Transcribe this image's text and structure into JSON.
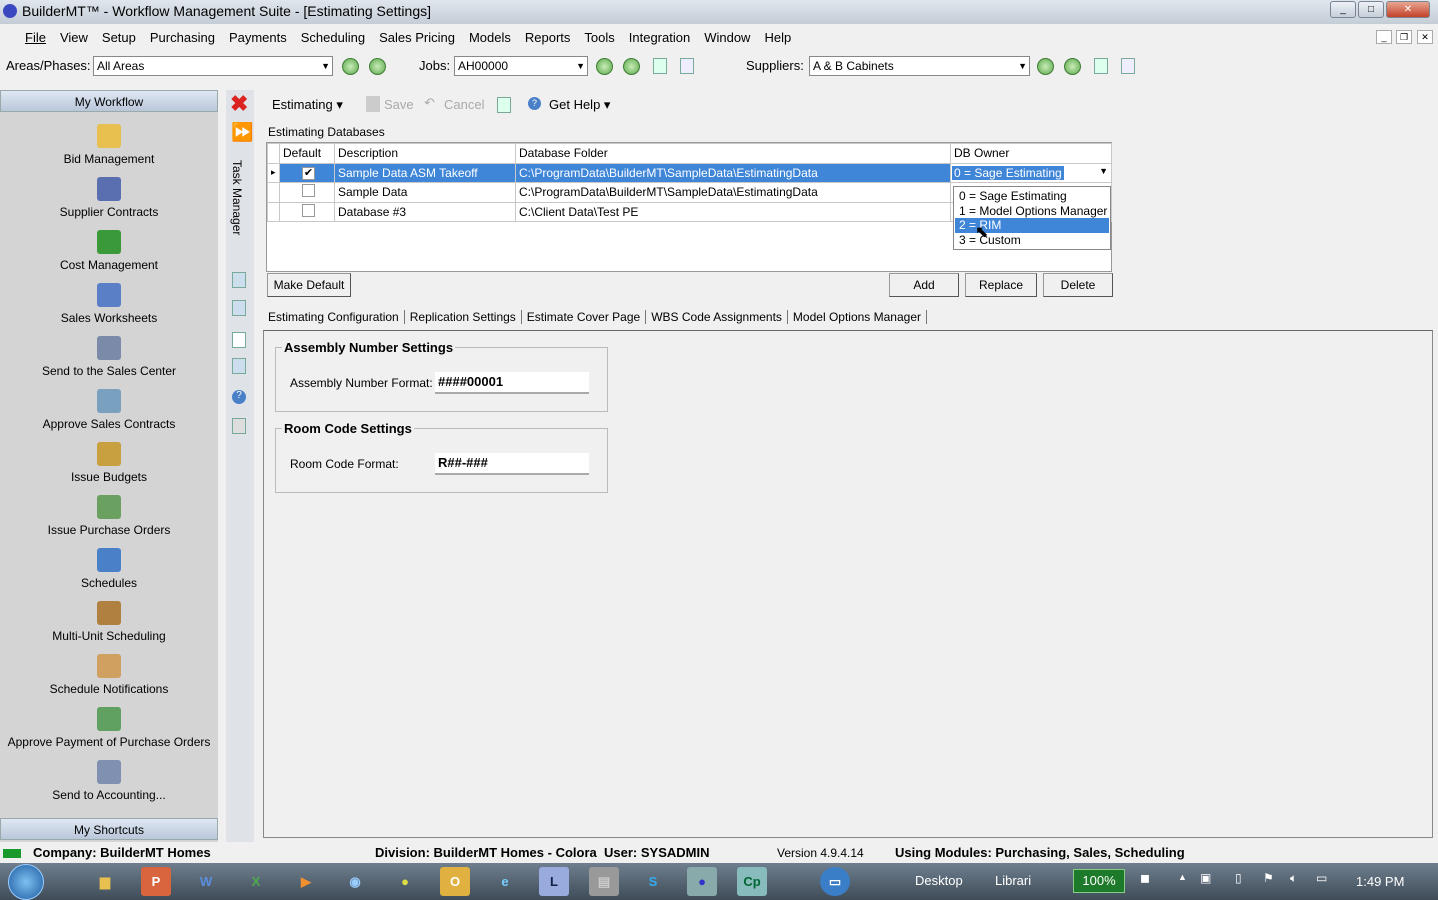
{
  "window": {
    "title": "BuilderMT™ - Workflow Management Suite - [Estimating Settings]"
  },
  "menu": [
    "File",
    "View",
    "Setup",
    "Purchasing",
    "Payments",
    "Scheduling",
    "Sales Pricing",
    "Models",
    "Reports",
    "Tools",
    "Integration",
    "Window",
    "Help"
  ],
  "filters": {
    "areas_label": "Areas/Phases:",
    "areas_value": "All Areas",
    "jobs_label": "Jobs:",
    "jobs_value": "AH00000",
    "suppliers_label": "Suppliers:",
    "suppliers_value": "A & B Cabinets"
  },
  "sidebar": {
    "header": "My Workflow",
    "footer": "My Shortcuts",
    "items": [
      {
        "label": "Bid Management",
        "icon": "folder-globe-icon",
        "color": "#e8c050"
      },
      {
        "label": "Supplier Contracts",
        "icon": "contract-dollar-icon",
        "color": "#5a6fb0"
      },
      {
        "label": "Cost Management",
        "icon": "money-icon",
        "color": "#3a9a3a"
      },
      {
        "label": "Sales Worksheets",
        "icon": "worksheet-icon",
        "color": "#5b7fc7"
      },
      {
        "label": "Send to the Sales Center",
        "icon": "send-sales-icon",
        "color": "#7a8aa8"
      },
      {
        "label": "Approve Sales Contracts",
        "icon": "approve-contract-icon",
        "color": "#7aa0c0"
      },
      {
        "label": "Issue Budgets",
        "icon": "budget-icon",
        "color": "#c8a040"
      },
      {
        "label": "Issue Purchase Orders",
        "icon": "purchase-order-icon",
        "color": "#6aa060"
      },
      {
        "label": "Schedules",
        "icon": "schedule-clock-icon",
        "color": "#4a80c8"
      },
      {
        "label": "Multi-Unit Scheduling",
        "icon": "calendar-icon",
        "color": "#b08040"
      },
      {
        "label": "Schedule Notifications",
        "icon": "notification-icon",
        "color": "#d0a060"
      },
      {
        "label": "Approve Payment of Purchase Orders",
        "icon": "approve-payment-icon",
        "color": "#60a060"
      },
      {
        "label": "Send to Accounting...",
        "icon": "accounting-icon",
        "color": "#8090b0"
      }
    ]
  },
  "task_manager_label": "Task Manager",
  "toolbar": {
    "module": "Estimating",
    "save": "Save",
    "cancel": "Cancel",
    "help": "Get Help"
  },
  "databases": {
    "title": "Estimating Databases",
    "columns": [
      "Default",
      "Description",
      "Database Folder",
      "DB Owner"
    ],
    "rows": [
      {
        "default": true,
        "description": "Sample Data ASM Takeoff",
        "folder": "C:\\ProgramData\\BuilderMT\\SampleData\\EstimatingData",
        "owner": "0 = Sage Estimating",
        "selected": true
      },
      {
        "default": false,
        "description": "Sample Data",
        "folder": "C:\\ProgramData\\BuilderMT\\SampleData\\EstimatingData",
        "owner": ""
      },
      {
        "default": false,
        "description": "Database #3",
        "folder": "C:\\Client Data\\Test PE",
        "owner": ""
      }
    ],
    "owner_options": [
      "0 = Sage Estimating",
      "1 = Model Options Manager",
      "2 = RIM",
      "3 = Custom"
    ],
    "highlighted_option": "2 = RIM",
    "buttons": {
      "make_default": "Make Default",
      "add": "Add",
      "replace": "Replace",
      "delete": "Delete"
    }
  },
  "tabs": [
    "Estimating Configuration",
    "Replication Settings",
    "Estimate Cover Page",
    "WBS Code Assignments",
    "Model Options Manager"
  ],
  "assembly": {
    "title": "Assembly Number Settings",
    "label": "Assembly Number Format:",
    "value": "####00001"
  },
  "room": {
    "title": "Room Code Settings",
    "label": "Room Code Format:",
    "value": "R##-###"
  },
  "status": {
    "company": "Company: BuilderMT Homes",
    "division": "Division: BuilderMT Homes - Colora",
    "user": "User: SYSADMIN",
    "version": "Version 4.9.4.14",
    "modules": "Using Modules: Purchasing, Sales, Scheduling"
  },
  "taskbar": {
    "desktop": "Desktop",
    "libraries": "Librari",
    "battery": "100%",
    "time": "1:49 PM"
  }
}
